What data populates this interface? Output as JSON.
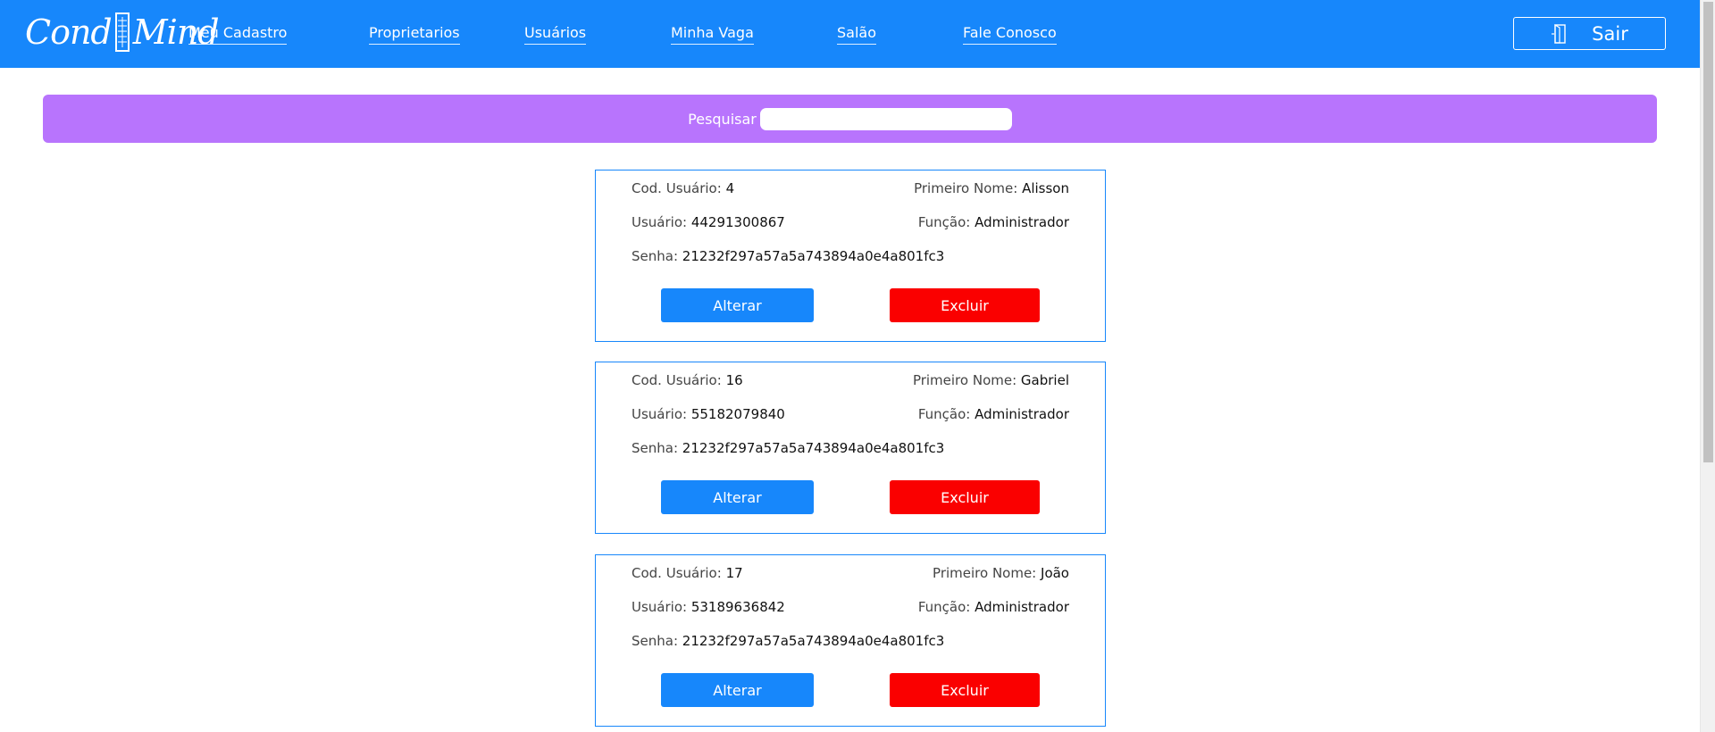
{
  "header": {
    "logo_text_left": "Cond",
    "logo_text_right": "Mind",
    "nav": [
      {
        "label": "Meu Cadastro"
      },
      {
        "label": "Proprietarios"
      },
      {
        "label": "Usuários"
      },
      {
        "label": "Minha Vaga"
      },
      {
        "label": "Salão"
      },
      {
        "label": "Fale Conosco"
      }
    ],
    "logout_label": "Sair",
    "logout_icon": "door-exit-icon"
  },
  "search": {
    "label": "Pesquisar",
    "value": "",
    "placeholder": ""
  },
  "labels": {
    "cod": "Cod. Usuário:",
    "first_name": "Primeiro Nome:",
    "user": "Usuário:",
    "role": "Função:",
    "password": "Senha:"
  },
  "users": [
    {
      "cod": "4",
      "first_name": "Alisson",
      "user": "44291300867",
      "role": "Administrador",
      "password": "21232f297a57a5a743894a0e4a801fc3",
      "alter_label": "Alterar",
      "delete_label": "Excluir"
    },
    {
      "cod": "16",
      "first_name": "Gabriel",
      "user": "55182079840",
      "role": "Administrador",
      "password": "21232f297a57a5a743894a0e4a801fc3",
      "alter_label": "Alterar",
      "delete_label": "Excluir"
    },
    {
      "cod": "17",
      "first_name": "João",
      "user": "53189636842",
      "role": "Administrador",
      "password": "21232f297a57a5a743894a0e4a801fc3",
      "alter_label": "Alterar",
      "delete_label": "Excluir"
    }
  ],
  "colors": {
    "navbar": "#1787fb",
    "search_band": "#b874fd",
    "alter_button": "#1787fb",
    "delete_button": "#fa0000"
  }
}
